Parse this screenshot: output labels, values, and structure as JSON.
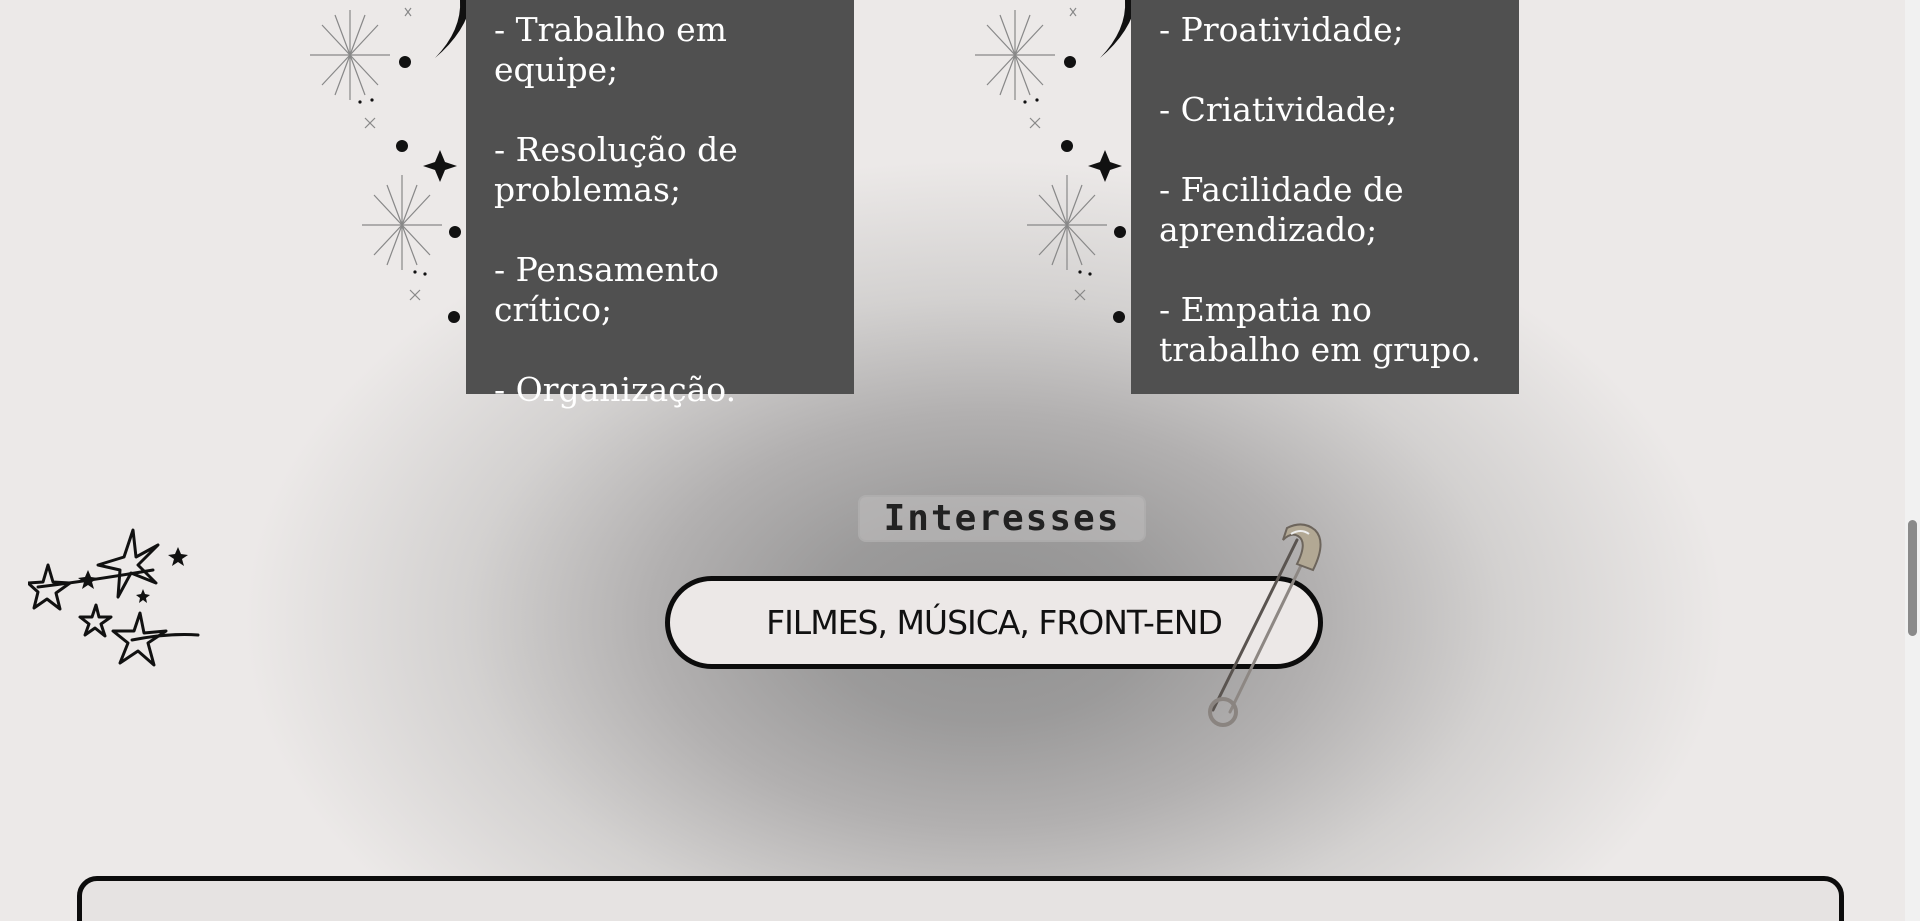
{
  "skills": {
    "left": [
      "- Trabalho em equipe;",
      "- Resolução de problemas;",
      "- Pensamento crítico;",
      "- Organização."
    ],
    "right": [
      "- Proatividade;",
      "- Criatividade;",
      "- Facilidade de aprendizado;",
      "- Empatia no trabalho em grupo."
    ]
  },
  "interests": {
    "heading": "Interesses",
    "value": "FILMES, MÚSICA, FRONT-END"
  },
  "decorations": [
    "sparkle-stars-icon",
    "doodle-stars-icon",
    "safety-pin-icon"
  ],
  "colors": {
    "background": "#ece9e8",
    "card": "#505050",
    "card_text": "#ffffff",
    "outline": "#0c0c0c"
  }
}
